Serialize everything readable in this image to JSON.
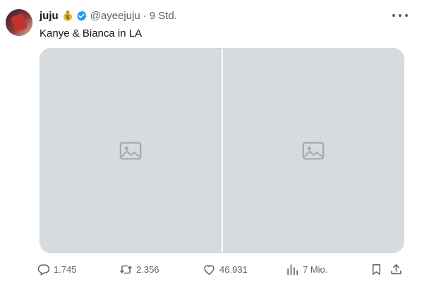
{
  "user": {
    "display_name": "juju",
    "name_emoji": "money-bag-emoji",
    "verified_icon": "verified-badge-icon",
    "handle": "@ayeejuju",
    "separator": "·",
    "time": "9 Std."
  },
  "tweet": {
    "text": "Kanye & Bianca in LA",
    "media_count": 2
  },
  "actions": {
    "reply_count": "1.745",
    "repost_count": "2.356",
    "like_count": "46.931",
    "views_count": "7 Mio."
  },
  "icons": [
    "more-icon",
    "reply-icon",
    "repost-icon",
    "like-icon",
    "views-icon",
    "bookmark-icon",
    "share-icon",
    "image-placeholder-icon"
  ],
  "colors": {
    "text_primary": "#0f1419",
    "text_secondary": "#536471",
    "verified_blue": "#1d9bf0",
    "border": "#cfd9de"
  }
}
